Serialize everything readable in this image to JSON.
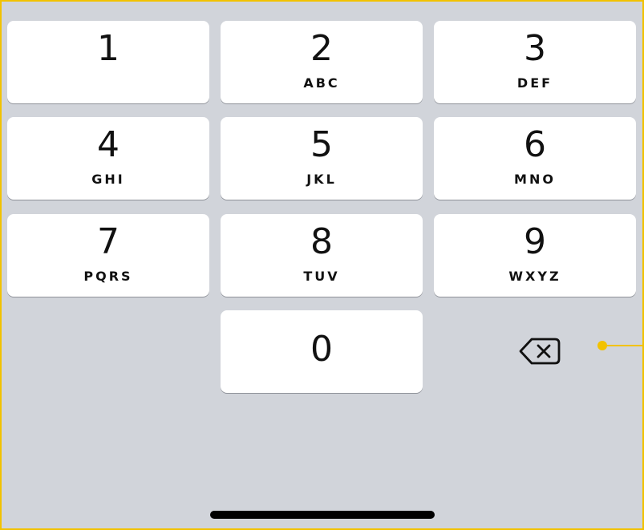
{
  "keypad": {
    "keys": [
      {
        "digit": "1",
        "letters": ""
      },
      {
        "digit": "2",
        "letters": "ABC"
      },
      {
        "digit": "3",
        "letters": "DEF"
      },
      {
        "digit": "4",
        "letters": "GHI"
      },
      {
        "digit": "5",
        "letters": "JKL"
      },
      {
        "digit": "6",
        "letters": "MNO"
      },
      {
        "digit": "7",
        "letters": "PQRS"
      },
      {
        "digit": "8",
        "letters": "TUV"
      },
      {
        "digit": "9",
        "letters": "WXYZ"
      },
      {
        "digit": "0",
        "letters": ""
      }
    ],
    "backspace_icon": "delete-backward-icon"
  },
  "colors": {
    "keyboard_background": "#d1d4da",
    "key_background": "#ffffff",
    "annotation_accent": "#f2c200",
    "text": "#111111"
  }
}
